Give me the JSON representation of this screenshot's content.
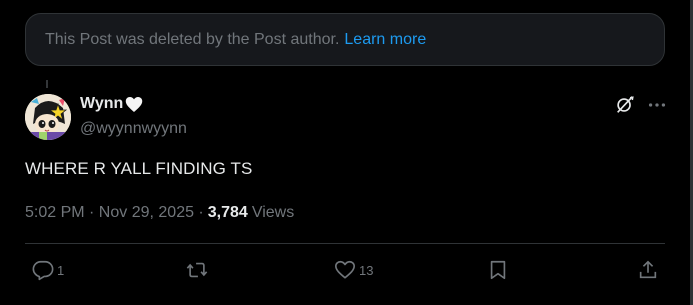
{
  "deleted_notice": {
    "text": "This Post was deleted by the Post author.",
    "link": "Learn more"
  },
  "author": {
    "display_name": "Wynn",
    "name_emoji": "white-heart",
    "handle": "@wyynnwyynn",
    "avatar_icon": "avatar-anime-character-with-star"
  },
  "post": {
    "text": "WHERE R YALL FINDING TS",
    "time": "5:02 PM · Nov 29, 2025 ·",
    "views_count": "3,784",
    "views_label": "Views"
  },
  "header_actions": {
    "grok_icon": "grok-icon",
    "more_icon": "more-icon"
  },
  "actions": {
    "reply_count": "1",
    "repost_count": "",
    "like_count": "13"
  },
  "colors": {
    "background": "#000000",
    "text_primary": "#e7e9ea",
    "text_secondary": "#71767b",
    "link": "#1d9bf0",
    "border": "#2f3336",
    "notice_bg": "#16181c"
  }
}
